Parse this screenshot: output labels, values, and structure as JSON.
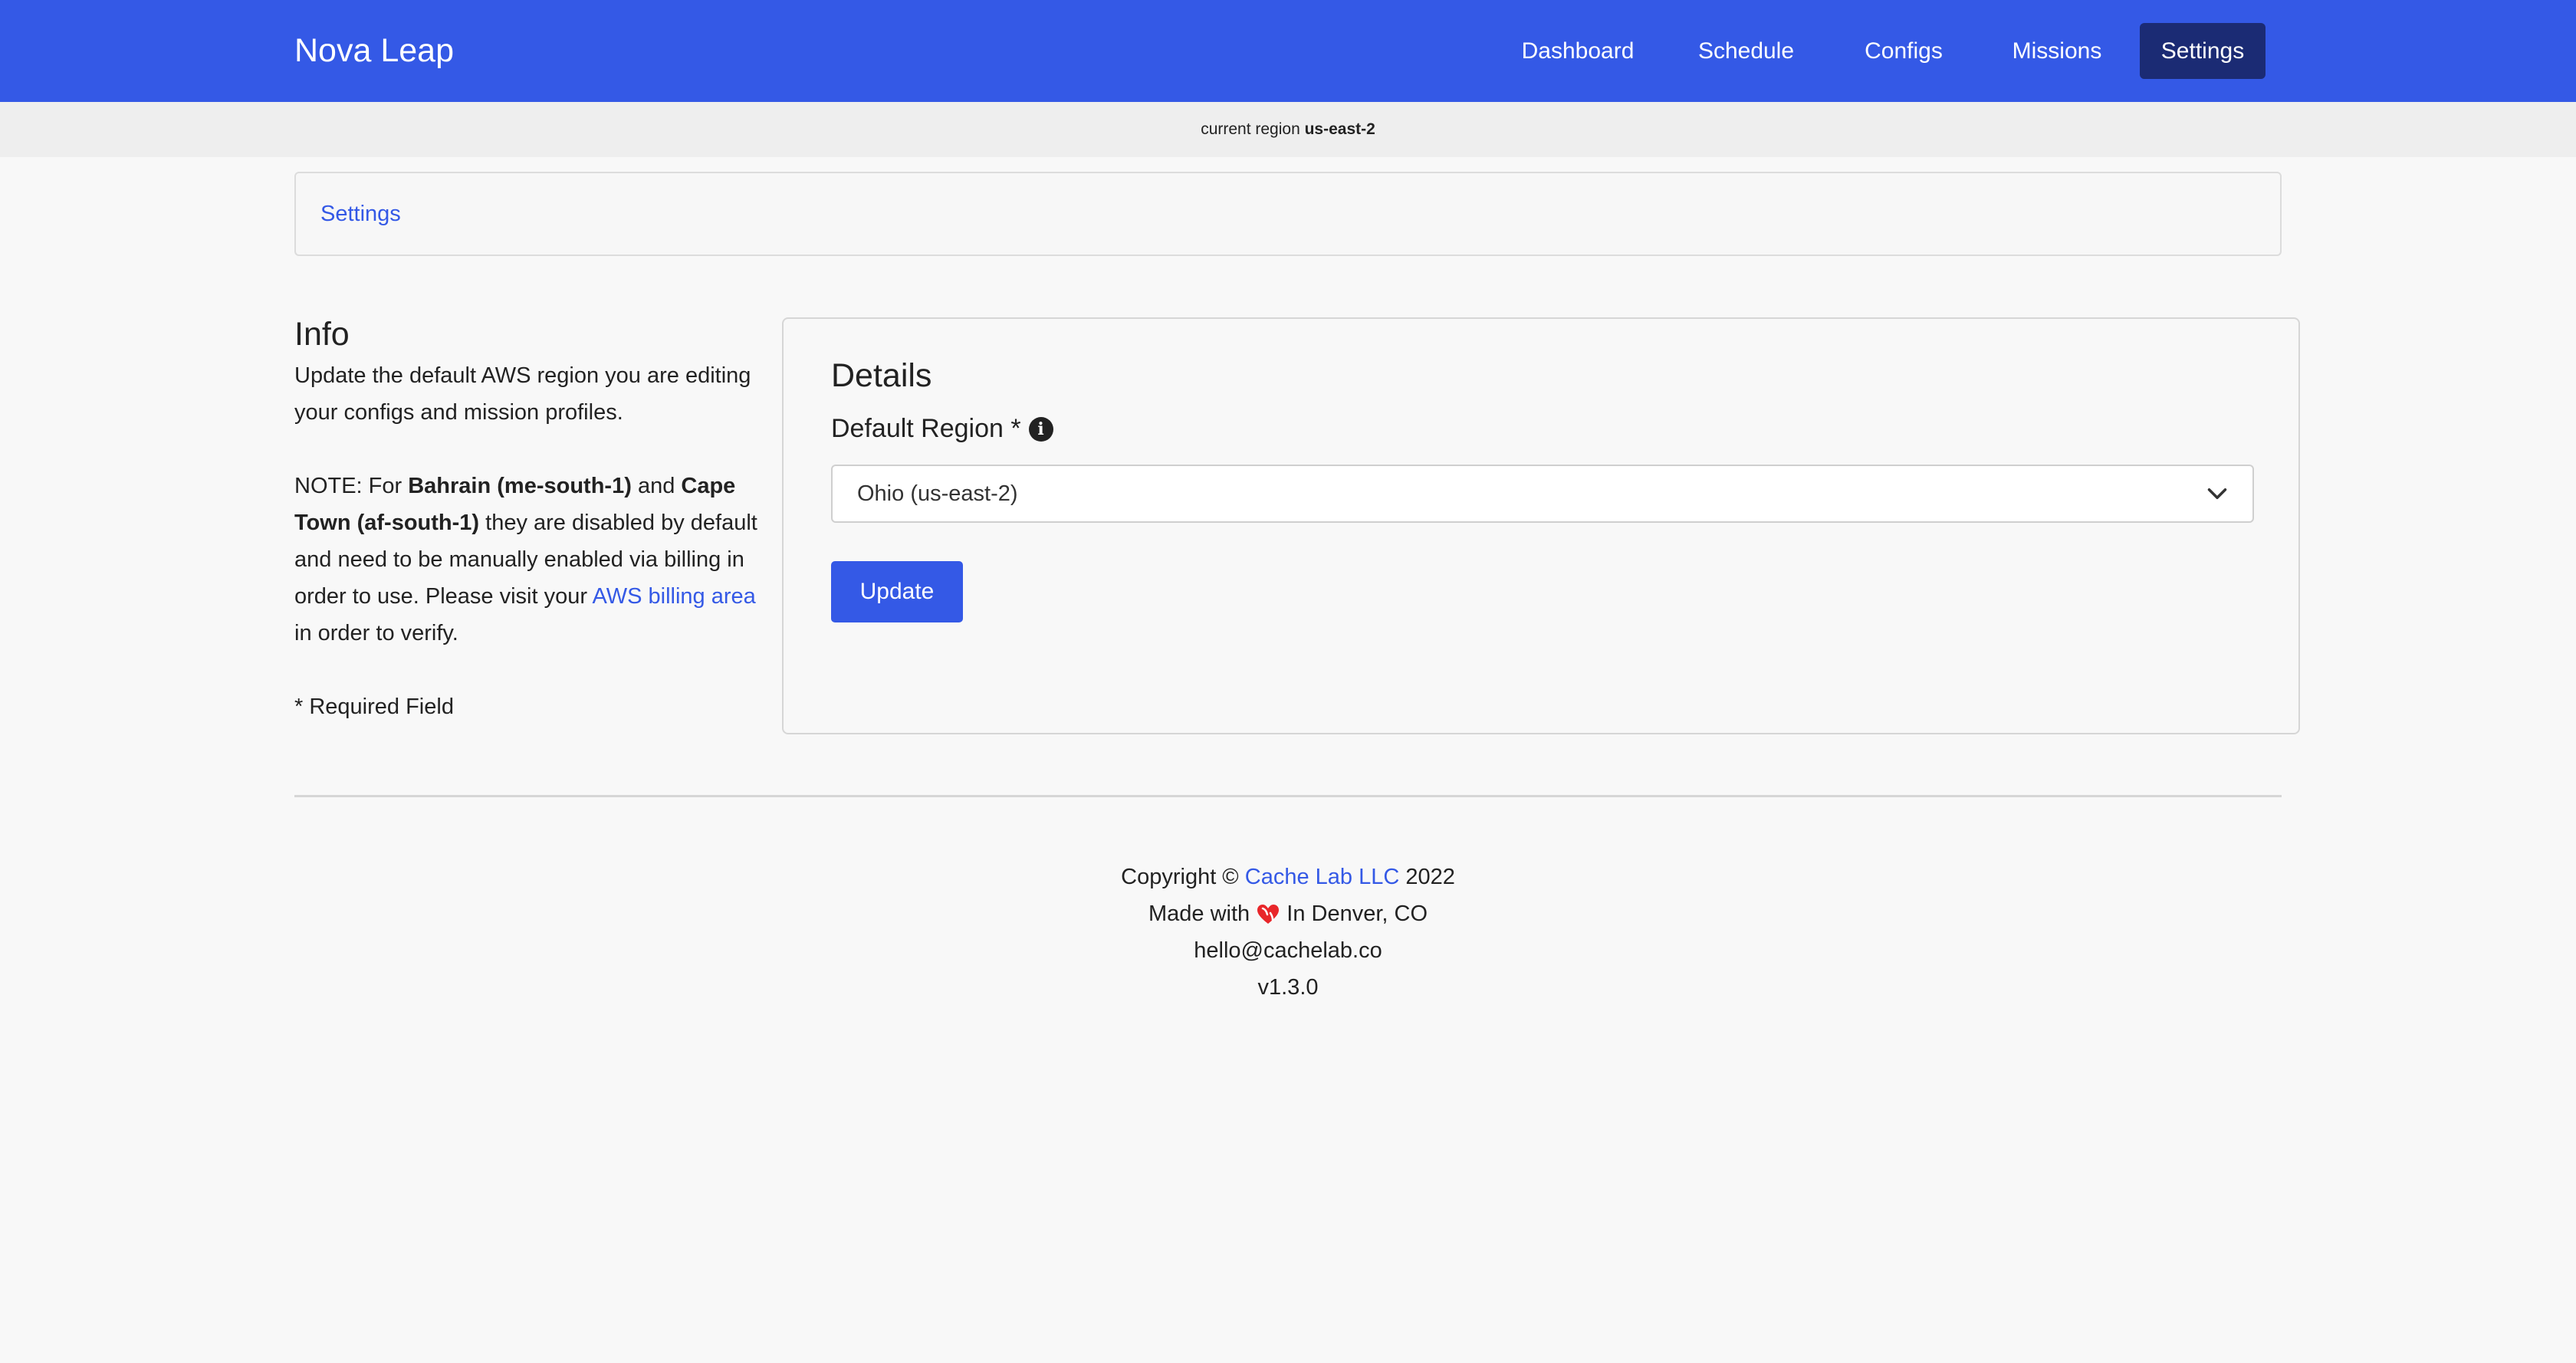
{
  "app": {
    "title": "Nova Leap"
  },
  "nav": {
    "items": [
      {
        "label": "Dashboard"
      },
      {
        "label": "Schedule"
      },
      {
        "label": "Configs"
      },
      {
        "label": "Missions"
      },
      {
        "label": "Settings",
        "active": true
      }
    ]
  },
  "region_bar": {
    "prefix": "current region",
    "region": "us-east-2"
  },
  "breadcrumb": {
    "label": "Settings"
  },
  "info": {
    "heading": "Info",
    "description": "Update the default AWS region you are editing your configs and mission profiles.",
    "note_prefix": "NOTE: For",
    "bahrain": "Bahrain (me-south-1)",
    "and": "and",
    "capetown": "Cape Town (af-south-1)",
    "note_mid": "they are disabled by default and need to be manually enabled via billing in order to use. Please visit your",
    "billing_link": "AWS billing area",
    "note_end": "in order to verify.",
    "required": "* Required Field"
  },
  "details": {
    "heading": "Details",
    "region_label": "Default Region *",
    "region_value": "Ohio (us-east-2)",
    "update_label": "Update"
  },
  "footer": {
    "copyright_prefix": "Copyright ©",
    "company": "Cache Lab LLC",
    "year": "2022",
    "made_with_prefix": "Made with",
    "made_with_suffix": "In Denver, CO",
    "email": "hello@cachelab.co",
    "version": "v1.3.0"
  },
  "colors": {
    "primary": "#3459e6",
    "nav_active": "#1b2b74",
    "background": "#f8f8f8",
    "heart": "#e8262a"
  }
}
